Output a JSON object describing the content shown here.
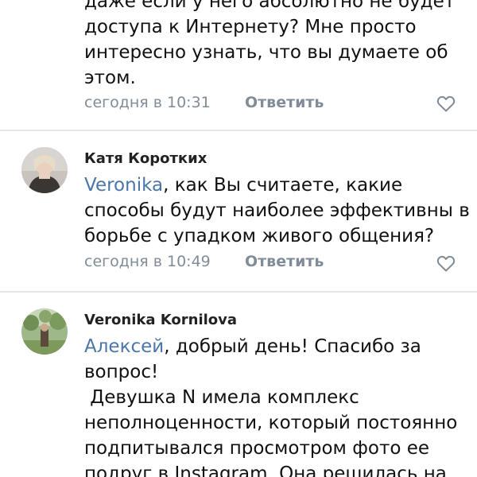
{
  "comments": [
    {
      "lines": [
        "даже если у него абсолютно не будет",
        "доступа к Интернету? Мне просто",
        "интересно узнать, что вы думаете об",
        "этом."
      ],
      "time": "сегодня в 10:31",
      "reply": "Ответить"
    },
    {
      "author": "Катя Коротких",
      "mention": "Veronika",
      "lines": [
        ", как Вы считаете, какие",
        "способы будут наиболее эффективны в",
        "борьбе с упадком живого общения?"
      ],
      "time": "сегодня в 10:49",
      "reply": "Ответить"
    },
    {
      "author": "Veronika Kornilova",
      "mention": "Алексей",
      "lines": [
        ", добрый день! Спасибо за",
        "вопрос!",
        " Девушка N имела комплекс",
        "неполноценности, который постоянно",
        "подпитывался просмотром фото ее",
        "подруг в Instagram. Она решилась на"
      ]
    }
  ],
  "colors": {
    "text": "#111111",
    "mention": "#4a76a8",
    "meta": "#818c99",
    "divider": "#e4e6ea"
  },
  "icons": {
    "like": "heart-outline-icon"
  }
}
